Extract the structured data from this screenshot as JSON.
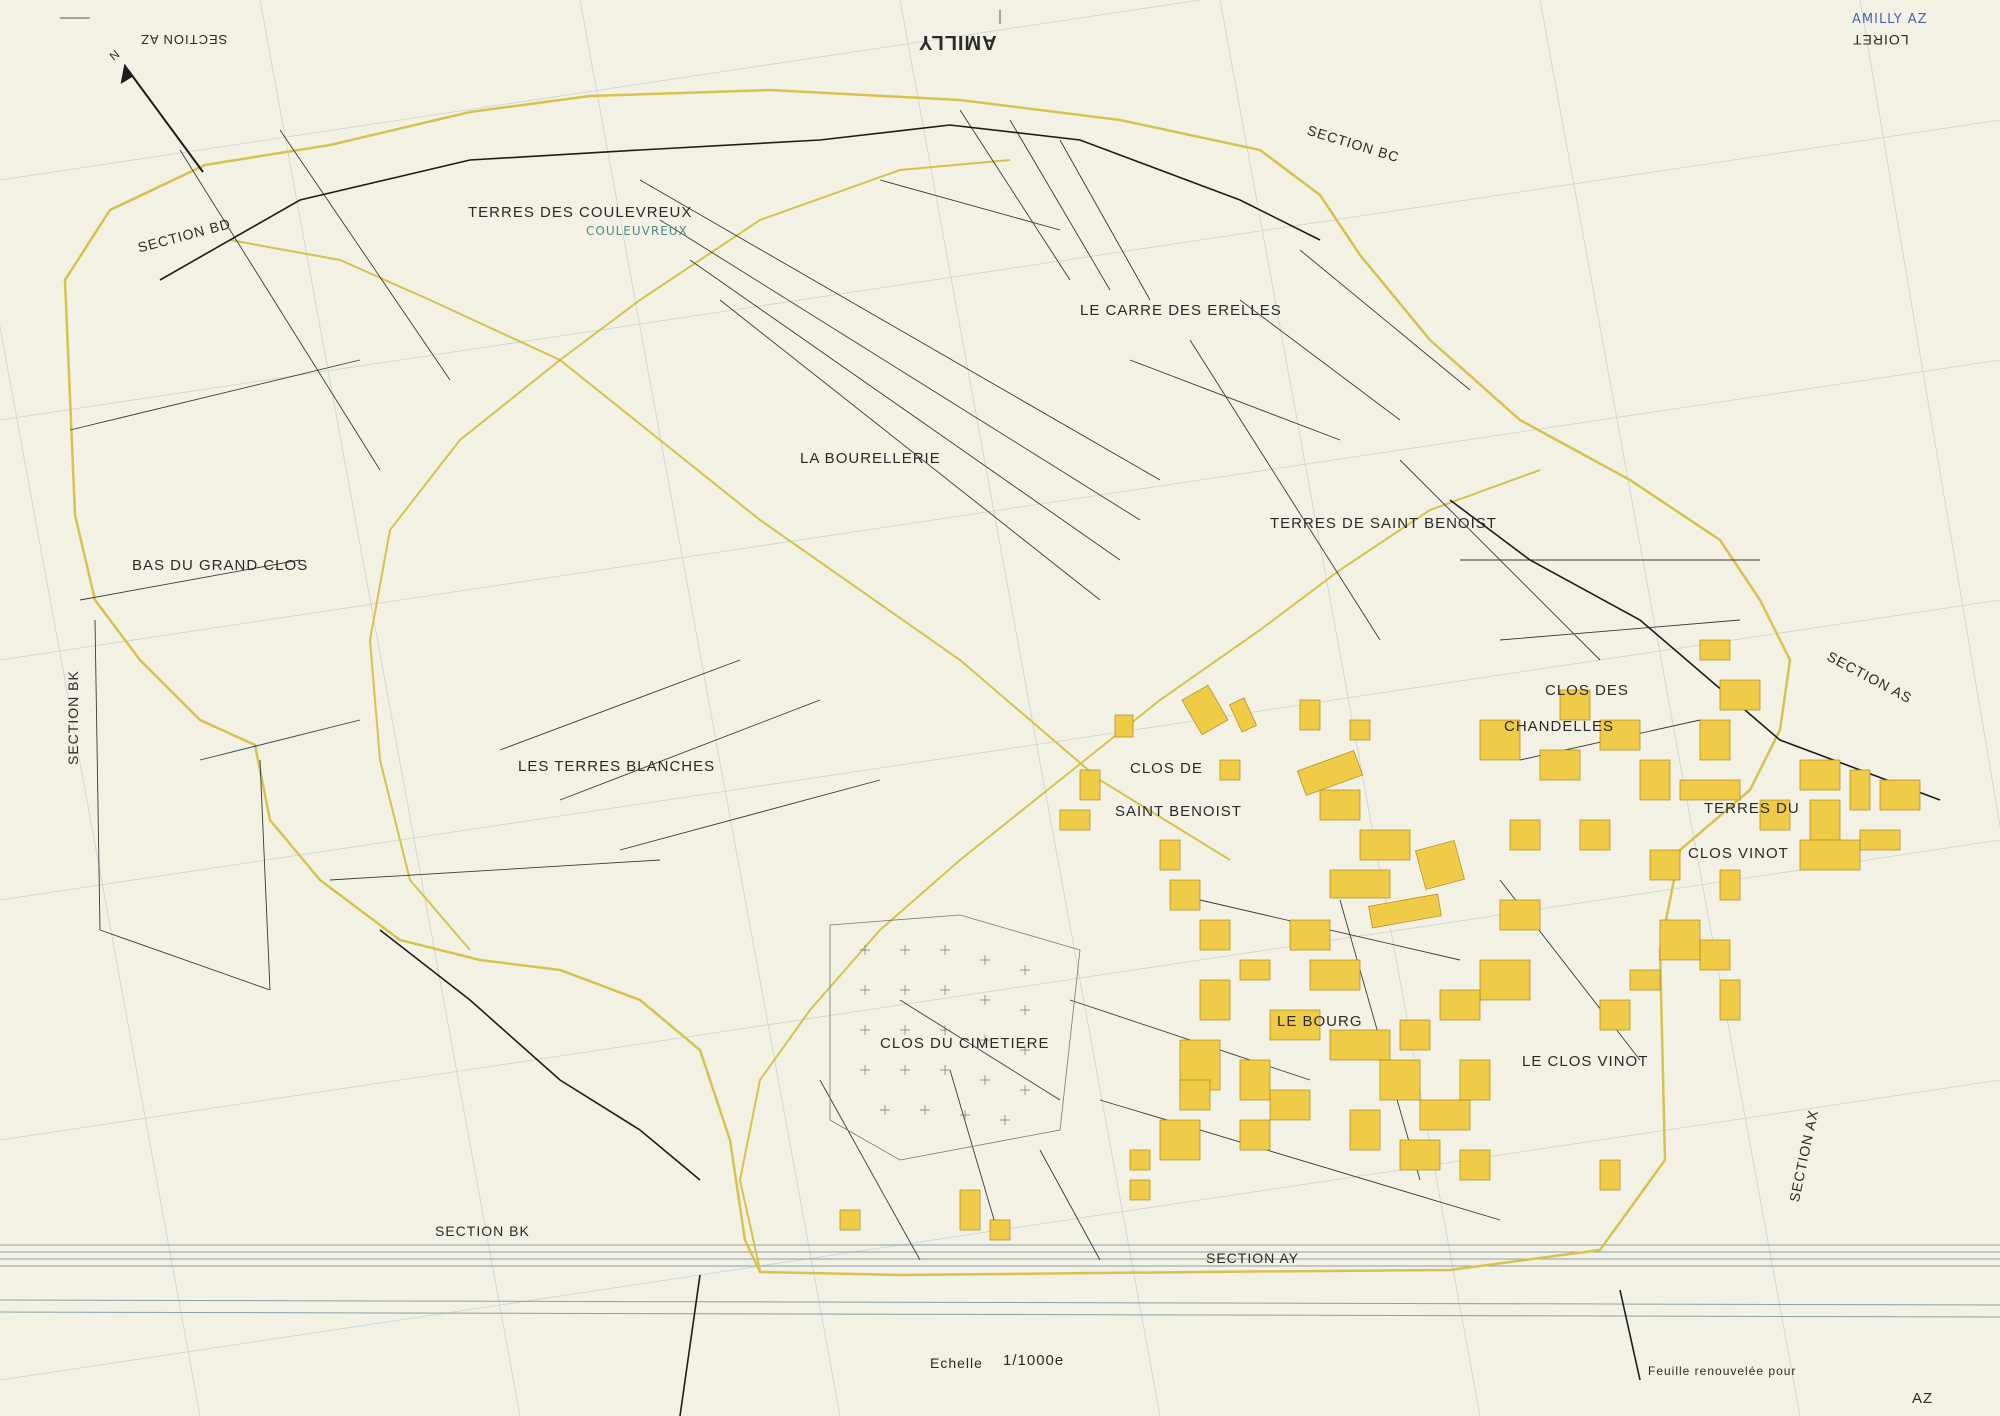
{
  "header": {
    "commune": "AMILLY",
    "department": "LOIRET",
    "section_top_left": "SECTION AZ",
    "top_right_tag": "AMILLY AZ",
    "north": "N"
  },
  "sections": {
    "bd": "SECTION BD",
    "bc": "SECTION BC",
    "bk_left": "SECTION BK",
    "bk_bottom": "SECTION BK",
    "as": "SECTION AS",
    "ax": "SECTION AX",
    "ay": "SECTION AY"
  },
  "lieux_dits": {
    "coulevreux": "TERRES DES COULEVREUX",
    "coulevreux_hand": "COULEUVREUX",
    "erelles": "LE CARRE DES ERELLES",
    "bourellerie": "LA BOURELLERIE",
    "saint_benoist": "TERRES DE SAINT BENOIST",
    "grand_clos": "BAS DU GRAND CLOS",
    "terres_blanches": "LES TERRES BLANCHES",
    "clos_st_benoist_1": "CLOS DE",
    "clos_st_benoist_2": "SAINT BENOIST",
    "chandelles_1": "CLOS DES",
    "chandelles_2": "CHANDELLES",
    "terres_clos_vinot_1": "TERRES DU",
    "terres_clos_vinot_2": "CLOS VINOT",
    "cimetiere": "CLOS DU CIMETIERE",
    "bourg": "LE BOURG",
    "clos_vinot": "LE CLOS VINOT"
  },
  "footer": {
    "scale_label": "Echelle",
    "scale_value": "1/1000e",
    "renewed": "Feuille renouvelée pour",
    "sheet_code": "AZ"
  },
  "colors": {
    "paper": "#f2f1e4",
    "boundary": "#d8c45a",
    "building": "#f0cd4a",
    "line": "#2b2b2b",
    "grid": "#b9c7cc"
  }
}
